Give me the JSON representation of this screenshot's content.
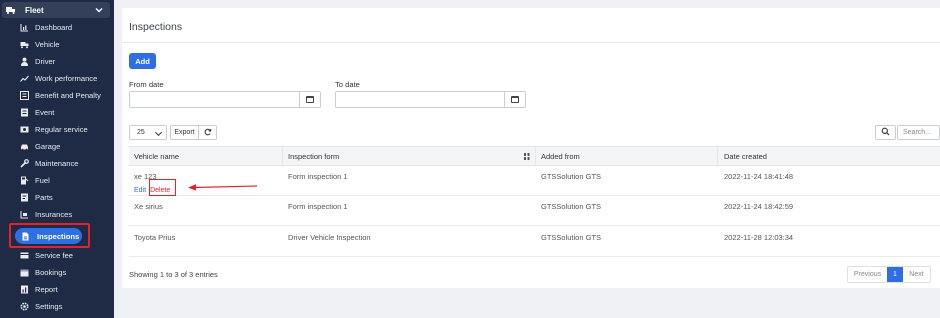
{
  "sidebar": {
    "group_label": "Fleet",
    "items": [
      {
        "label": "Dashboard",
        "icon": "chart-icon"
      },
      {
        "label": "Vehicle",
        "icon": "truck-icon"
      },
      {
        "label": "Driver",
        "icon": "user-icon"
      },
      {
        "label": "Work performance",
        "icon": "trend-icon"
      },
      {
        "label": "Benefit and Penalty",
        "icon": "list-icon"
      },
      {
        "label": "Event",
        "icon": "event-icon"
      },
      {
        "label": "Regular service",
        "icon": "service-icon"
      },
      {
        "label": "Garage",
        "icon": "car-icon"
      },
      {
        "label": "Maintenance",
        "icon": "wrench-icon"
      },
      {
        "label": "Fuel",
        "icon": "fuel-icon"
      },
      {
        "label": "Parts",
        "icon": "parts-icon"
      },
      {
        "label": "Insurances",
        "icon": "insurance-icon"
      }
    ],
    "active_item": {
      "label": "Inspections",
      "icon": "document-icon"
    },
    "items_after": [
      {
        "label": "Service fee",
        "icon": "fee-icon"
      },
      {
        "label": "Bookings",
        "icon": "booking-icon"
      },
      {
        "label": "Report",
        "icon": "report-icon"
      },
      {
        "label": "Settings",
        "icon": "gear-icon"
      }
    ]
  },
  "main": {
    "title": "Inspections",
    "add_label": "Add",
    "from_date_label": "From date",
    "to_date_label": "To date",
    "from_date_value": "",
    "to_date_value": "",
    "page_size": "25",
    "export_label": "Export",
    "search_placeholder": "Search..."
  },
  "table": {
    "columns": [
      "Vehicle name",
      "Inspection form",
      "Added from",
      "Date created"
    ],
    "rows": [
      {
        "vehicle": "xe 123",
        "form": "Form inspection 1",
        "added_from": "GTSSolution GTS",
        "date": "2022-11-24 18:41:48"
      },
      {
        "vehicle": "Xe sirius",
        "form": "Form inspection 1",
        "added_from": "GTSSolution GTS",
        "date": "2022-11-24 18:42:59"
      },
      {
        "vehicle": "Toyota Prius",
        "form": "Driver Vehicle Inspection",
        "added_from": "GTSSolution GTS",
        "date": "2022-11-28 12:03:34"
      }
    ],
    "edit_label": "Edit",
    "delete_label": "Delete"
  },
  "footer": {
    "info": "Showing 1 to 3 of 3 entries",
    "previous_label": "Previous",
    "page": "1",
    "next_label": "Next"
  },
  "colors": {
    "accent": "#2f6fe4",
    "sidebar": "#1f2a44",
    "highlight": "#e0242b"
  }
}
